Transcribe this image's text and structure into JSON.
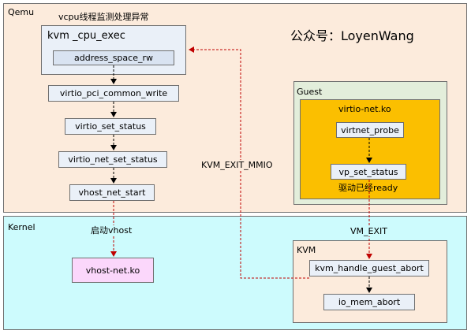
{
  "watermark": "公众号：LoyenWang",
  "regions": {
    "qemu": "Qemu",
    "kernel": "Kernel",
    "guest": "Guest",
    "virtio_net_ko": "virtio-net.ko",
    "kvm": "KVM"
  },
  "qemu_nodes": {
    "vcpu_caption": "vcpu线程监测处理异常",
    "kvm_cpu_exec": "kvm _cpu_exec",
    "address_space_rw": "address_space_rw",
    "virtio_pci_common_write": "virtio_pci_common_write",
    "virtio_set_status": "virtio_set_status",
    "virtio_net_set_status": "virtio_net_set_status",
    "vhost_net_start": "vhost_net_start"
  },
  "guest_nodes": {
    "virtnet_probe": "virtnet_probe",
    "vp_set_status": "vp_set_status",
    "driver_ready": "驱动已经ready"
  },
  "kernel_nodes": {
    "vhost_net_ko": "vhost-net.ko",
    "kvm_handle_guest_abort": "kvm_handle_guest_abort",
    "io_mem_abort": "io_mem_abort"
  },
  "edge_labels": {
    "start_vhost": "启动vhost",
    "kvm_exit_mmio": "KVM_EXIT_MMIO",
    "vm_exit": "VM_EXIT"
  },
  "colors": {
    "qemu_bg": "#fcebdc",
    "kernel_bg": "#cdfbfd",
    "guest_bg": "#e3eedb",
    "virtio_bg": "#fbbf00",
    "kvm_bg": "#fcebdc",
    "vhost_bg": "#fbd7fb",
    "node_bg": "#eaf0f8",
    "red_arrow": "#c00000",
    "black_arrow": "#000000"
  }
}
